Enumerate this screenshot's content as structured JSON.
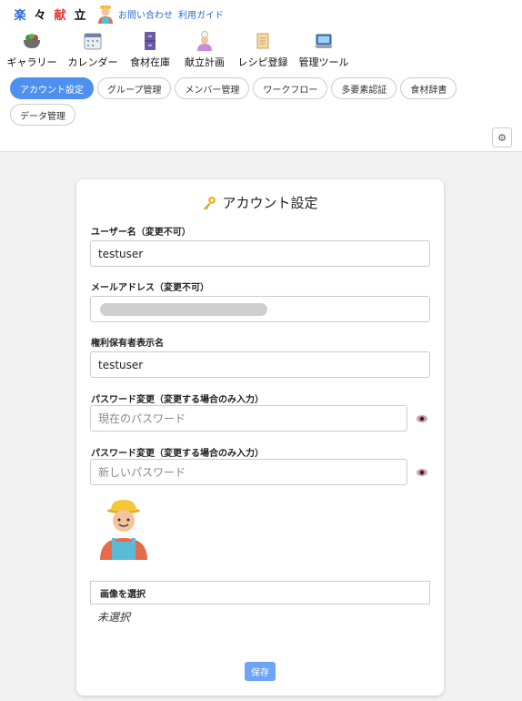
{
  "brand": {
    "logo_chars": [
      "楽",
      "々",
      "献",
      "立"
    ]
  },
  "top_links": {
    "contact": "お問い合わせ",
    "guide": "利用ガイド"
  },
  "nav": [
    {
      "label": "ギャラリー",
      "icon": "salad-bowl-icon"
    },
    {
      "label": "カレンダー",
      "icon": "calendar-icon"
    },
    {
      "label": "食材在庫",
      "icon": "cabinet-icon"
    },
    {
      "label": "献立計画",
      "icon": "cook-icon"
    },
    {
      "label": "レシピ登録",
      "icon": "scroll-icon"
    },
    {
      "label": "管理ツール",
      "icon": "laptop-icon"
    }
  ],
  "subtabs": [
    {
      "label": "アカウント設定",
      "active": true
    },
    {
      "label": "グループ管理",
      "active": false
    },
    {
      "label": "メンバー管理",
      "active": false
    },
    {
      "label": "ワークフロー",
      "active": false
    },
    {
      "label": "多要素認証",
      "active": false
    },
    {
      "label": "食材辞書",
      "active": false
    },
    {
      "label": "データ管理",
      "active": false
    }
  ],
  "settings_glyph": "⚙",
  "card": {
    "title_icon": "key-icon",
    "title": "アカウント設定",
    "username_label": "ユーザー名（変更不可）",
    "username_value": "testuser",
    "email_label": "メールアドレス（変更不可）",
    "rights_label": "権利保有者表示名",
    "rights_value": "testuser",
    "pw_current_label": "パスワード変更（変更する場合のみ入力）",
    "pw_current_placeholder": "現在のパスワード",
    "pw_new_label": "パスワード変更（変更する場合のみ入力）",
    "pw_new_placeholder": "新しいパスワード",
    "file_button": "画像を選択",
    "file_status": "未選択",
    "save_button": "保存"
  },
  "colors": {
    "accent": "#4d90f0",
    "save": "#6ea4f5",
    "link": "#2a6bd8"
  }
}
